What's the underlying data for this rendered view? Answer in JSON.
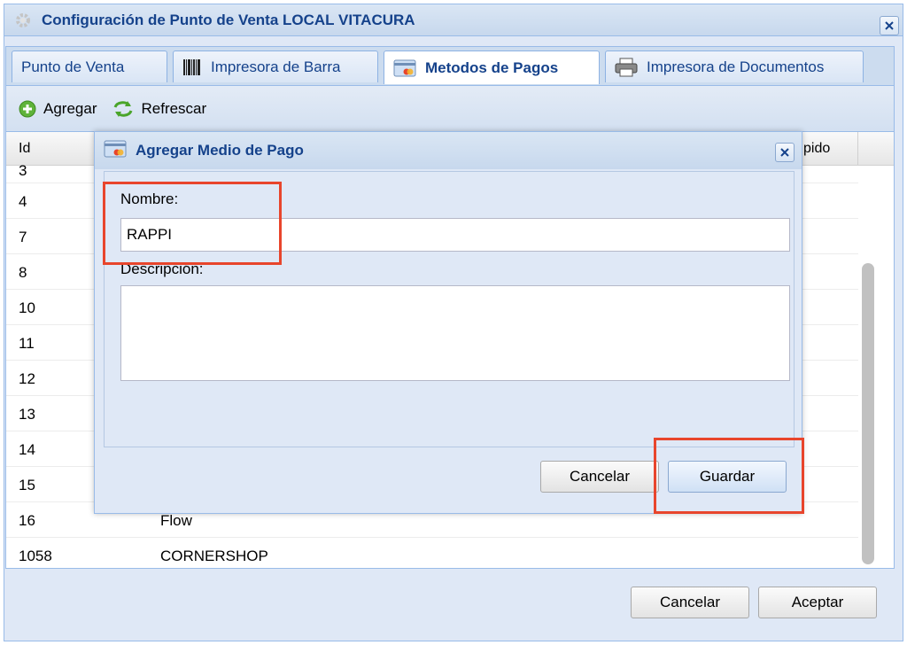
{
  "window": {
    "title": "Configuración de Punto de Venta LOCAL VITACURA"
  },
  "tabs": [
    {
      "label": "Punto de Venta",
      "icon": "none"
    },
    {
      "label": "Impresora de Barra",
      "icon": "barcode-icon"
    },
    {
      "label": "Metodos de Pagos",
      "icon": "payment-card-icon",
      "active": true
    },
    {
      "label": "Impresora de Documentos",
      "icon": "printer-icon"
    }
  ],
  "toolbar": {
    "add_label": "Agregar",
    "refresh_label": "Refrescar"
  },
  "grid": {
    "columns": {
      "id": "Id",
      "partial_right": "pido"
    },
    "rows": [
      {
        "id": "3",
        "name": ""
      },
      {
        "id": "4",
        "name": ""
      },
      {
        "id": "7",
        "name": ""
      },
      {
        "id": "8",
        "name": ""
      },
      {
        "id": "10",
        "name": ""
      },
      {
        "id": "11",
        "name": ""
      },
      {
        "id": "12",
        "name": ""
      },
      {
        "id": "13",
        "name": ""
      },
      {
        "id": "14",
        "name": ""
      },
      {
        "id": "15",
        "name": ""
      },
      {
        "id": "16",
        "name": "Flow"
      },
      {
        "id": "1058",
        "name": "CORNERSHOP"
      }
    ]
  },
  "footer": {
    "cancel_label": "Cancelar",
    "accept_label": "Aceptar"
  },
  "dialog": {
    "title": "Agregar Medio de Pago",
    "nombre_label": "Nombre:",
    "nombre_value": "RAPPI",
    "descripcion_label": "Descripción:",
    "descripcion_value": "",
    "cancel_label": "Cancelar",
    "save_label": "Guardar"
  },
  "colors": {
    "highlight": "#e8452c",
    "title_blue": "#15428b"
  }
}
